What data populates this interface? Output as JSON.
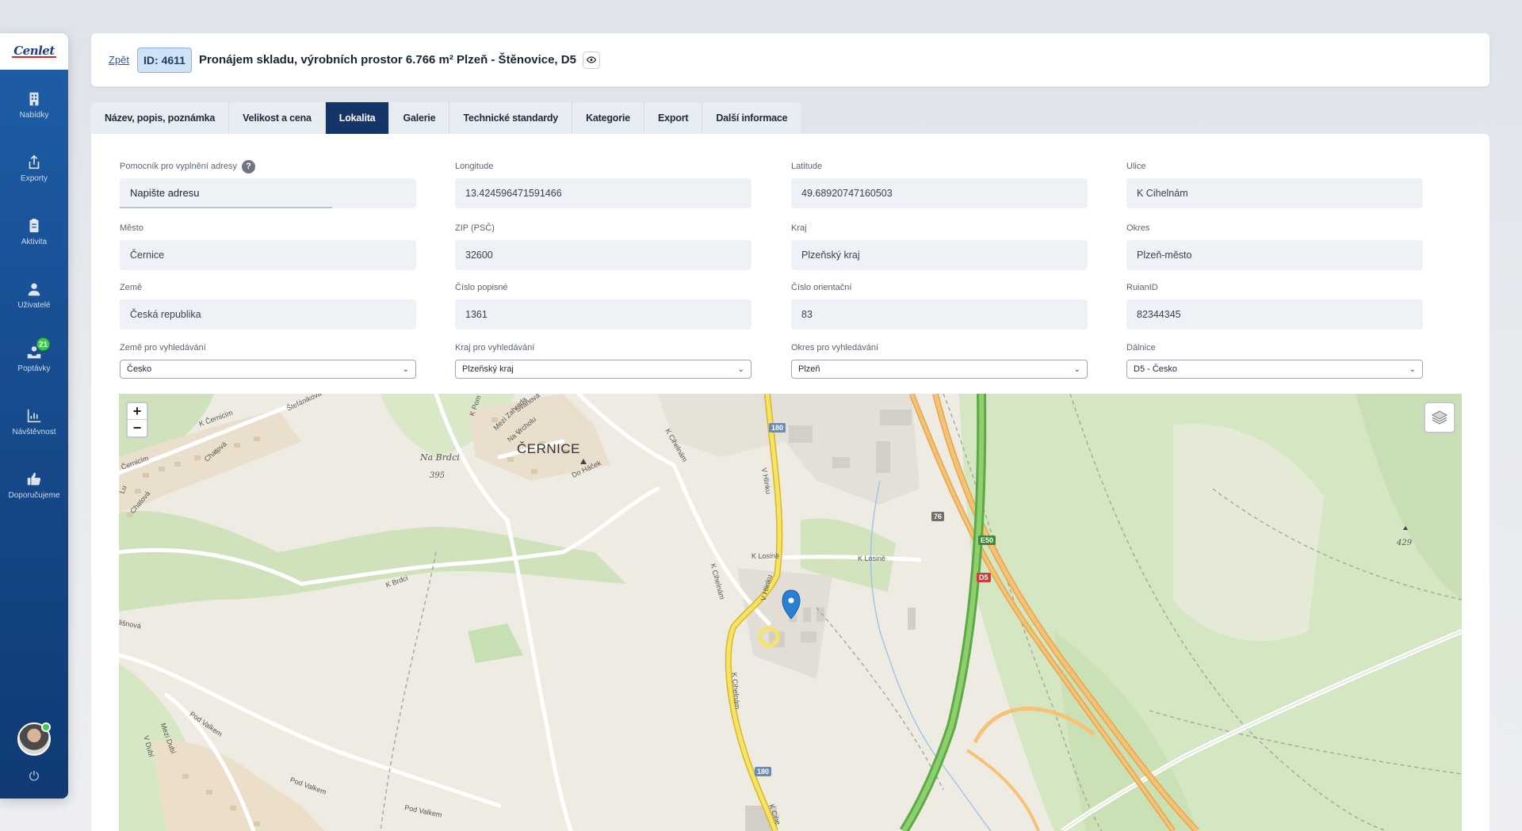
{
  "sidebar": {
    "logo": "Cenlet",
    "items": [
      {
        "label": "Nabídky",
        "icon": "building-icon"
      },
      {
        "label": "Exporty",
        "icon": "share-icon"
      },
      {
        "label": "Aktivita",
        "icon": "clipboard-icon"
      },
      {
        "label": "Uživatelé",
        "icon": "user-icon"
      },
      {
        "label": "Poptávky",
        "icon": "inbox-icon",
        "badge": "21"
      },
      {
        "label": "Návštěvnost",
        "icon": "bar-chart-icon"
      },
      {
        "label": "Doporučujeme",
        "icon": "thumbs-up-icon"
      }
    ],
    "power_icon": "⏻"
  },
  "header": {
    "back_label": "Zpět",
    "id_label": "ID: 4611",
    "title": "Pronájem skladu, výrobních prostor 6.766 m² Plzeň - Štěnovice, D5"
  },
  "tabs": [
    {
      "label": "Název, popis, poznámka"
    },
    {
      "label": "Velikost a cena"
    },
    {
      "label": "Lokalita",
      "active": true
    },
    {
      "label": "Galerie"
    },
    {
      "label": "Technické standardy"
    },
    {
      "label": "Kategorie"
    },
    {
      "label": "Export"
    },
    {
      "label": "Další informace"
    }
  ],
  "form": {
    "address_helper": {
      "label": "Pomocník pro vyplnění adresy",
      "help": "?",
      "placeholder": "Napište adresu"
    },
    "longitude": {
      "label": "Longitude",
      "value": "13.424596471591466"
    },
    "latitude": {
      "label": "Latitude",
      "value": "49.68920747160503"
    },
    "street": {
      "label": "Ulice",
      "value": "K Cihelnám"
    },
    "city": {
      "label": "Město",
      "value": "Černice"
    },
    "zip": {
      "label": "ZIP (PSČ)",
      "value": "32600"
    },
    "region": {
      "label": "Kraj",
      "value": "Plzeňský kraj"
    },
    "district": {
      "label": "Okres",
      "value": "Plzeň-město"
    },
    "country": {
      "label": "Země",
      "value": "Česká republika"
    },
    "house_number": {
      "label": "Číslo popisné",
      "value": "1361"
    },
    "orientation_number": {
      "label": "Číslo orientační",
      "value": "83"
    },
    "ruian": {
      "label": "RuianID",
      "value": "82344345"
    },
    "search_country": {
      "label": "Země pro vyhledávání",
      "value": "Česko"
    },
    "search_region": {
      "label": "Kraj pro vyhledávání",
      "value": "Plzeňský kraj"
    },
    "search_district": {
      "label": "Okres pro vyhledávání",
      "value": "Plzeň"
    },
    "highway": {
      "label": "Dálnice",
      "value": "D5 - Česko"
    }
  },
  "map": {
    "zoom_in": "+",
    "zoom_out": "−",
    "town": "ČERNICE",
    "hill_name": "Na Brdci",
    "hill_elevation": "395",
    "peak_elevation": "429",
    "route_180_a": "180",
    "route_180_b": "180",
    "route_e50": "E50",
    "route_d5": "D5",
    "route_exit": "76",
    "streets": [
      "K Černicím",
      "Štefánikova",
      "Chatová",
      "Chatová",
      "Černicím",
      "Mezi Zahrada",
      "K Pom",
      "Svahová",
      "Na Vrcholu",
      "Do Háček",
      "K Cihelnám",
      "V Hlinku",
      "K Losině",
      "K Losině",
      "K Cihelnám",
      "V Hlinku",
      "K Brdci",
      "K Cihelnám",
      "K Cihe",
      "Pod Valkem",
      "Mezi Dubí",
      "V Dubí",
      "Pod Valkem",
      "Pod Valkem",
      "lišnová",
      "Lu"
    ]
  }
}
